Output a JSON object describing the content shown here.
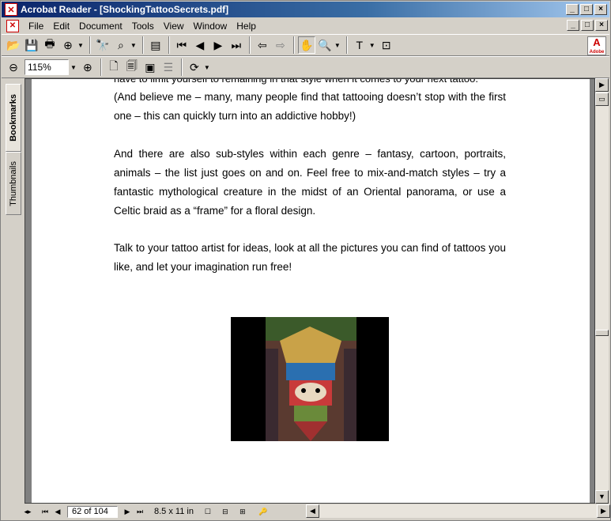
{
  "window": {
    "title": "Acrobat Reader - [ShockingTattooSecrets.pdf]",
    "app_icon": "acrobat-icon",
    "controls": [
      "_",
      "□",
      "×"
    ]
  },
  "menu": {
    "items": [
      "File",
      "Edit",
      "Document",
      "Tools",
      "View",
      "Window",
      "Help"
    ]
  },
  "toolbar": {
    "zoom_value": "115%"
  },
  "brand": {
    "logo": "A",
    "sub": "Adobe"
  },
  "sidebar": {
    "tabs": [
      "Bookmarks",
      "Thumbnails"
    ]
  },
  "document": {
    "clipped_line": "have to limit yourself to remaining in that style when it comes to your next tattoo.",
    "paragraphs": [
      "(And believe me – many, many people find that tattooing doesn’t stop with the first one – this can quickly turn into an addictive hobby!)",
      "And there are also sub-styles within each genre – fantasy, cartoon, portraits, animals – the list just goes on and on.  Feel free to mix-and-match styles – try a fantastic mythological creature in the midst of an Oriental panorama, or use a Celtic braid as a “frame” for a floral design.",
      "Talk to your tattoo artist for ideas, look at all the pictures you can find of tattoos you like, and let your imagination run free!"
    ]
  },
  "status": {
    "page": "62 of 104",
    "page_size": "8.5 x 11 in"
  }
}
